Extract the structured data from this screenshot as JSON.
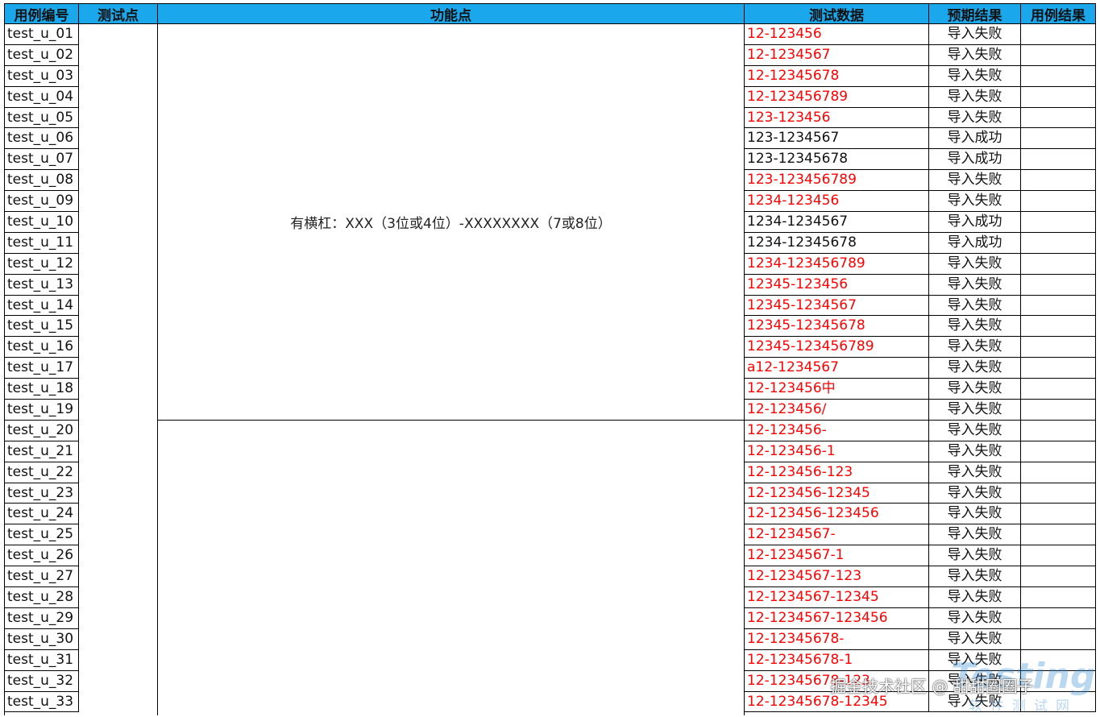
{
  "header": {
    "case_id": "用例编号",
    "test_point": "测试点",
    "feature": "功能点",
    "test_data": "测试数据",
    "expected": "预期结果",
    "result": "用例结果"
  },
  "group1_feature": "有横杠：XXX（3位或4位）-XXXXXXXX（7或8位）",
  "group2_feature": "",
  "rows": [
    {
      "id": "test_u_01",
      "data": "12-123456",
      "expected": "导入失败",
      "color": "#ff0000"
    },
    {
      "id": "test_u_02",
      "data": "12-1234567",
      "expected": "导入失败",
      "color": "#ff0000"
    },
    {
      "id": "test_u_03",
      "data": "12-12345678",
      "expected": "导入失败",
      "color": "#ff0000"
    },
    {
      "id": "test_u_04",
      "data": "12-123456789",
      "expected": "导入失败",
      "color": "#ff0000"
    },
    {
      "id": "test_u_05",
      "data": "123-123456",
      "expected": "导入失败",
      "color": "#ff0000"
    },
    {
      "id": "test_u_06",
      "data": "123-1234567",
      "expected": "导入成功",
      "color": "#111111"
    },
    {
      "id": "test_u_07",
      "data": "123-12345678",
      "expected": "导入成功",
      "color": "#111111"
    },
    {
      "id": "test_u_08",
      "data": "123-123456789",
      "expected": "导入失败",
      "color": "#ff0000"
    },
    {
      "id": "test_u_09",
      "data": "1234-123456",
      "expected": "导入失败",
      "color": "#ff0000"
    },
    {
      "id": "test_u_10",
      "data": "1234-1234567",
      "expected": "导入成功",
      "color": "#111111"
    },
    {
      "id": "test_u_11",
      "data": "1234-12345678",
      "expected": "导入成功",
      "color": "#111111"
    },
    {
      "id": "test_u_12",
      "data": "1234-123456789",
      "expected": "导入失败",
      "color": "#ff0000"
    },
    {
      "id": "test_u_13",
      "data": "12345-123456",
      "expected": "导入失败",
      "color": "#ff0000"
    },
    {
      "id": "test_u_14",
      "data": "12345-1234567",
      "expected": "导入失败",
      "color": "#ff0000"
    },
    {
      "id": "test_u_15",
      "data": "12345-12345678",
      "expected": "导入失败",
      "color": "#ff0000"
    },
    {
      "id": "test_u_16",
      "data": "12345-123456789",
      "expected": "导入失败",
      "color": "#ff0000"
    },
    {
      "id": "test_u_17",
      "data": "a12-1234567",
      "expected": "导入失败",
      "color": "#ff0000"
    },
    {
      "id": "test_u_18",
      "data": "12-123456中",
      "expected": "导入失败",
      "color": "#ff0000"
    },
    {
      "id": "test_u_19",
      "data": "12-123456/",
      "expected": "导入失败",
      "color": "#ff0000"
    },
    {
      "id": "test_u_20",
      "data": "12-123456-",
      "expected": "导入失败",
      "color": "#ff0000"
    },
    {
      "id": "test_u_21",
      "data": "12-123456-1",
      "expected": "导入失败",
      "color": "#ff0000"
    },
    {
      "id": "test_u_22",
      "data": "12-123456-123",
      "expected": "导入失败",
      "color": "#ff0000"
    },
    {
      "id": "test_u_23",
      "data": "12-123456-12345",
      "expected": "导入失败",
      "color": "#ff0000"
    },
    {
      "id": "test_u_24",
      "data": "12-123456-123456",
      "expected": "导入失败",
      "color": "#ff0000"
    },
    {
      "id": "test_u_25",
      "data": "12-1234567-",
      "expected": "导入失败",
      "color": "#ff0000"
    },
    {
      "id": "test_u_26",
      "data": "12-1234567-1",
      "expected": "导入失败",
      "color": "#ff0000"
    },
    {
      "id": "test_u_27",
      "data": "12-1234567-123",
      "expected": "导入失败",
      "color": "#ff0000"
    },
    {
      "id": "test_u_28",
      "data": "12-1234567-12345",
      "expected": "导入失败",
      "color": "#ff0000"
    },
    {
      "id": "test_u_29",
      "data": "12-1234567-123456",
      "expected": "导入失败",
      "color": "#ff0000"
    },
    {
      "id": "test_u_30",
      "data": "12-12345678-",
      "expected": "导入失败",
      "color": "#ff0000"
    },
    {
      "id": "test_u_31",
      "data": "12-12345678-1",
      "expected": "导入失败",
      "color": "#ff0000"
    },
    {
      "id": "test_u_32",
      "data": "12-12345678-123",
      "expected": "导入失败",
      "color": "#ff0000"
    },
    {
      "id": "test_u_33",
      "data": "12-12345678-12345",
      "expected": "导入失败",
      "color": "#ff0000"
    }
  ],
  "watermark": "掘金技术社区 @ 甜甜圈圈子",
  "logo": {
    "text": "Testing",
    "subtext": "软件测试网"
  }
}
